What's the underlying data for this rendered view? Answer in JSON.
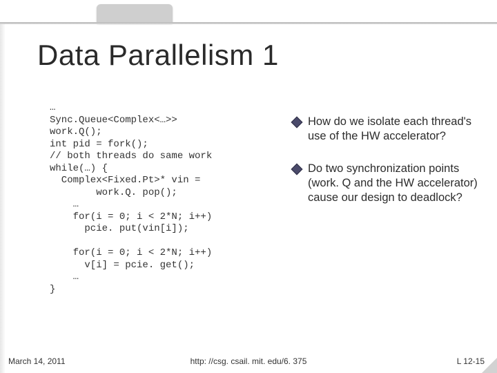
{
  "title": "Data Parallelism 1",
  "code": "…\nSync.Queue<Complex<…>>\nwork.Q();\nint pid = fork();\n// both threads do same work\nwhile(…) {\n  Complex<Fixed.Pt>* vin =\n        work.Q. pop();\n    …\n    for(i = 0; i < 2*N; i++)\n      pcie. put(vin[i]);\n\n    for(i = 0; i < 2*N; i++)\n      v[i] = pcie. get();\n    …\n}",
  "bullets": [
    "How do we isolate each thread's use of the HW accelerator?",
    "Do two synchronization points (work. Q and the HW accelerator) cause our design to deadlock?"
  ],
  "footer": {
    "date": "March 14, 2011",
    "url": "http: //csg. csail. mit. edu/6. 375",
    "page": "L 12-15"
  }
}
